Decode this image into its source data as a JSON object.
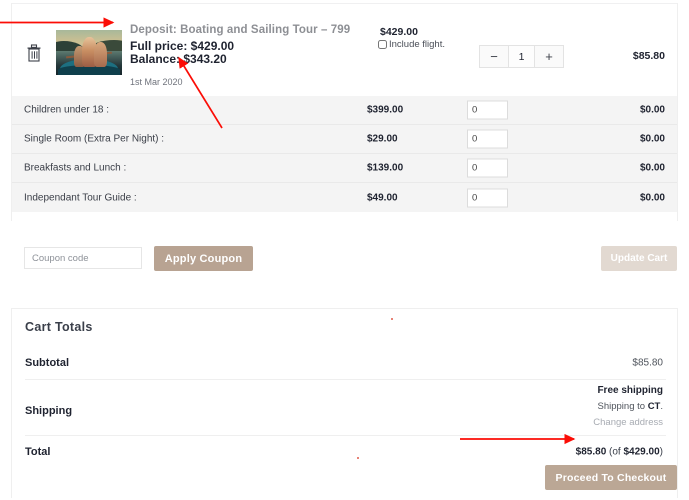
{
  "cart": {
    "product": {
      "remove_icon": "trash-icon",
      "thumbnail_alt": "boating-sailing-tour-photo",
      "title": "Deposit: Boating and Sailing Tour – 799",
      "full_price_line": "Full price: $429.00",
      "balance_line": "Balance: $343.20",
      "date": "1st Mar 2020",
      "unit_price": "$429.00",
      "flight_option_label": "Include flight.",
      "flight_checked": false,
      "qty_decrement": "−",
      "qty_value": "1",
      "qty_increment": "+",
      "line_subtotal": "$85.80"
    },
    "extras_rows": [
      {
        "name": "Children under 18 :",
        "price": "$399.00",
        "qty": "0",
        "total": "$0.00"
      },
      {
        "name": "Single Room (Extra Per Night) :",
        "price": "$29.00",
        "qty": "0",
        "total": "$0.00"
      },
      {
        "name": "Breakfasts and Lunch :",
        "price": "$139.00",
        "qty": "0",
        "total": "$0.00"
      },
      {
        "name": "Independant Tour Guide :",
        "price": "$49.00",
        "qty": "0",
        "total": "$0.00"
      }
    ],
    "coupon": {
      "placeholder": "Coupon code",
      "value": "",
      "apply_label": "Apply Coupon",
      "update_label": "Update Cart"
    }
  },
  "totals": {
    "heading": "Cart Totals",
    "subtotal_label": "Subtotal",
    "subtotal_value": "$85.80",
    "shipping_label": "Shipping",
    "shipping_method": "Free shipping",
    "shipping_to_prefix": "Shipping to ",
    "shipping_to_region": "CT",
    "shipping_to_suffix": ".",
    "change_address_label": "Change address",
    "total_label": "Total",
    "total_value": "$85.80",
    "total_of_prefix": " (of ",
    "total_of_value": "$429.00",
    "total_of_suffix": ")",
    "checkout_label": "Proceed To Checkout"
  },
  "annotations": {
    "arrow_color": "#fb0d06",
    "arrow_1_target": "product-title",
    "arrow_2_target": "balance-line",
    "arrow_3_target": "total-value"
  }
}
